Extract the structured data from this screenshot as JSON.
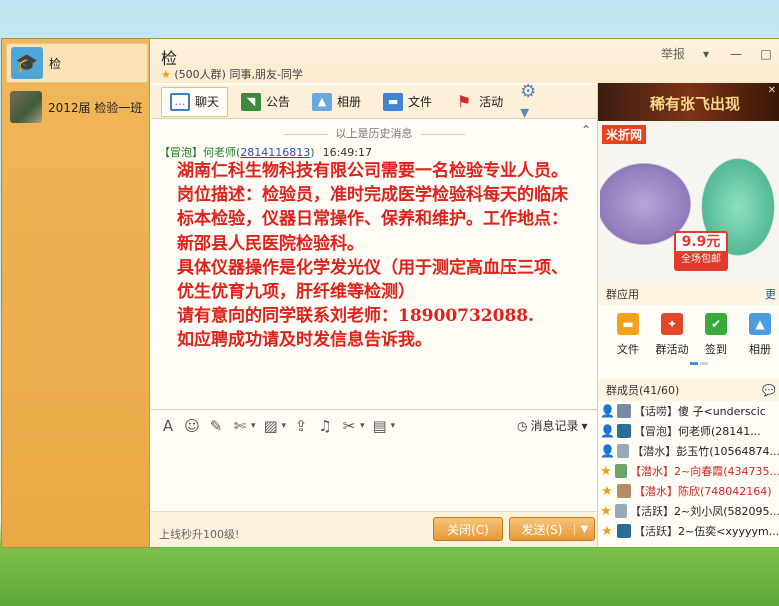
{
  "sidebar": {
    "items": [
      {
        "label": "检",
        "icon": "graduation-cap-icon",
        "active": true
      },
      {
        "label": "2012届 检验一班"
      }
    ]
  },
  "header": {
    "group_name": "检",
    "member_count": "(500人群)",
    "category": "同事,朋友-同学",
    "report": "举报",
    "report_caret": "▾",
    "minimize": "—",
    "maximize": "□"
  },
  "tabs": [
    {
      "label": "聊天",
      "icon": "chat-icon"
    },
    {
      "label": "公告",
      "icon": "notice-icon"
    },
    {
      "label": "相册",
      "icon": "album-icon"
    },
    {
      "label": "文件",
      "icon": "folder-icon"
    },
    {
      "label": "活动",
      "icon": "flag-icon"
    }
  ],
  "chat": {
    "history_divider": "以上是历史消息",
    "message": {
      "sender_tag": "【冒泡】何老师",
      "qq": "2814116813",
      "time": "16:49:17",
      "body_lines": [
        "湖南仁科生物科技有限公司需要一名检验专业人员。岗位描述：检验员，准时完成医学检验科每天的临床标本检验，仪器日常操作、保养和维护。工作地点：新邵县人民医院检验科。",
        "具体仪器操作是化学发光仪（用于测定高血压三项、优生优育九项，肝纤维等检测）",
        "请有意向的同学联系刘老师：18900732088.",
        "如应聘成功请及时发信息告诉我。"
      ]
    }
  },
  "toolbar": {
    "history_label": "消息记录"
  },
  "bottom": {
    "tip": "上线秒升100级!",
    "close_label": "关闭(C)",
    "send_label": "发送(S)"
  },
  "ad": {
    "banner_text": "稀有张飞出现",
    "brand": "米折网",
    "price": "9.9元",
    "free_shipping": "全场包邮"
  },
  "group_apps": {
    "title": "群应用",
    "more": "更",
    "items": [
      {
        "label": "文件",
        "icon": "folder-icon"
      },
      {
        "label": "群活动",
        "icon": "event-icon"
      },
      {
        "label": "签到",
        "icon": "checkin-icon"
      },
      {
        "label": "相册",
        "icon": "album-icon"
      }
    ]
  },
  "members": {
    "title": "群成员(41/60)",
    "list": [
      {
        "tag": "【话唠】",
        "name": "傻  子<underscic",
        "star": false,
        "red": false
      },
      {
        "tag": "【冒泡】",
        "name": "何老师(28141...",
        "star": false,
        "red": false
      },
      {
        "tag": "【潜水】",
        "name": "彭玉竹(10564874...",
        "star": false,
        "red": false
      },
      {
        "tag": "【潜水】",
        "name": "2~向春霞(434735...",
        "star": true,
        "red": true
      },
      {
        "tag": "【潜水】",
        "name": "陈欣(748042164)",
        "star": true,
        "red": true
      },
      {
        "tag": "【活跃】",
        "name": "2~刘小凤(582095...",
        "star": true,
        "red": false
      },
      {
        "tag": "【活跃】",
        "name": "2~伍奕<xyyyym...",
        "star": true,
        "red": false
      }
    ]
  },
  "colors": {
    "accent": "#e69a34",
    "message_text": "#e0211c",
    "sender": "#1f7a2c",
    "link": "#1f52c4"
  }
}
